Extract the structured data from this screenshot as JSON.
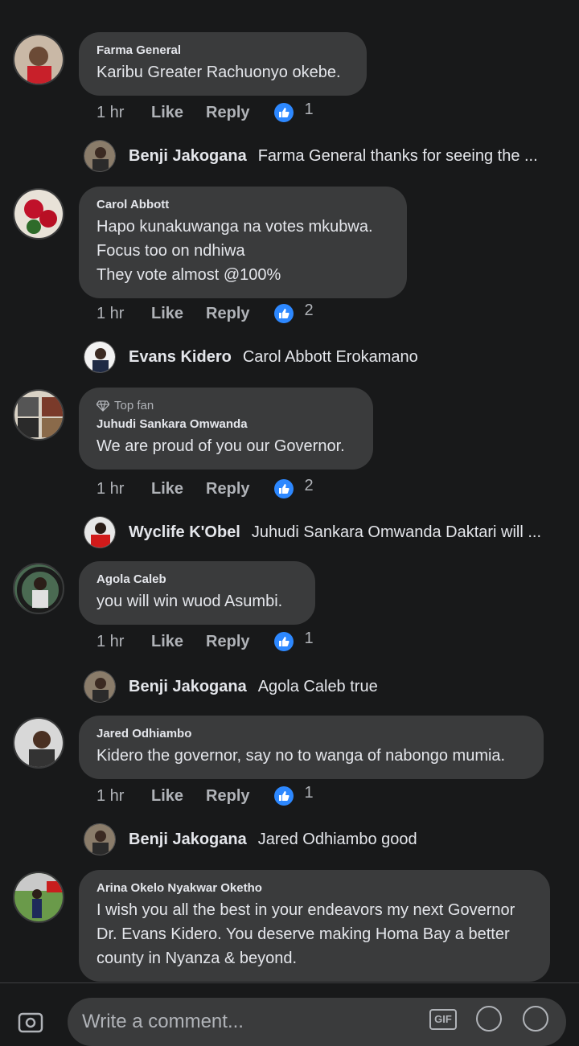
{
  "comments": [
    {
      "author": "Farma General",
      "badge": "",
      "lines": [
        "Karibu Greater Rachuonyo okebe."
      ],
      "time": "1 hr",
      "like": "Like",
      "reply": "Reply",
      "reactions": "1",
      "sub_reply": {
        "name": "Benji Jakogana",
        "text": "Farma General thanks for seeing the ..."
      }
    },
    {
      "author": "Carol Abbott",
      "badge": "",
      "lines": [
        "Hapo kunakuwanga na votes mkubwa.",
        "Focus too on ndhiwa",
        "They vote almost @100%"
      ],
      "time": "1 hr",
      "like": "Like",
      "reply": "Reply",
      "reactions": "2",
      "sub_reply": {
        "name": "Evans Kidero",
        "text": "Carol Abbott Erokamano"
      }
    },
    {
      "author": "Juhudi Sankara Omwanda",
      "badge": "Top fan",
      "lines": [
        "We are proud of you our Governor."
      ],
      "time": "1 hr",
      "like": "Like",
      "reply": "Reply",
      "reactions": "2",
      "sub_reply": {
        "name": "Wyclife K'Obel",
        "text": "Juhudi Sankara Omwanda Daktari will ..."
      }
    },
    {
      "author": "Agola Caleb",
      "badge": "",
      "lines": [
        "you will win wuod Asumbi."
      ],
      "time": "1 hr",
      "like": "Like",
      "reply": "Reply",
      "reactions": "1",
      "sub_reply": {
        "name": "Benji Jakogana",
        "text": "Agola Caleb true"
      }
    },
    {
      "author": "Jared Odhiambo",
      "badge": "",
      "lines": [
        "Kidero the governor, say no to wanga of nabongo mumia."
      ],
      "time": "1 hr",
      "like": "Like",
      "reply": "Reply",
      "reactions": "1",
      "sub_reply": {
        "name": "Benji Jakogana",
        "text": "Jared Odhiambo good"
      }
    },
    {
      "author": "Arina Okelo Nyakwar Oketho",
      "badge": "",
      "lines": [
        "I wish you all the best in your endeavors my next Governor",
        "Dr. Evans Kidero. You deserve making Homa Bay a better",
        "county in Nyanza & beyond."
      ],
      "time": "",
      "like": "",
      "reply": "",
      "reactions": "",
      "sub_reply": null
    }
  ],
  "composer": {
    "placeholder": "Write a comment...",
    "gif_label": "GIF",
    "camera_icon": "camera-icon",
    "at_icon": "mention-icon",
    "emoji_icon": "emoji-icon"
  },
  "colors": {
    "background": "#18191a",
    "bubble": "#3a3b3c",
    "text": "#e4e6eb",
    "secondary": "#b0b3b8",
    "like_blue": "#2d88ff"
  }
}
